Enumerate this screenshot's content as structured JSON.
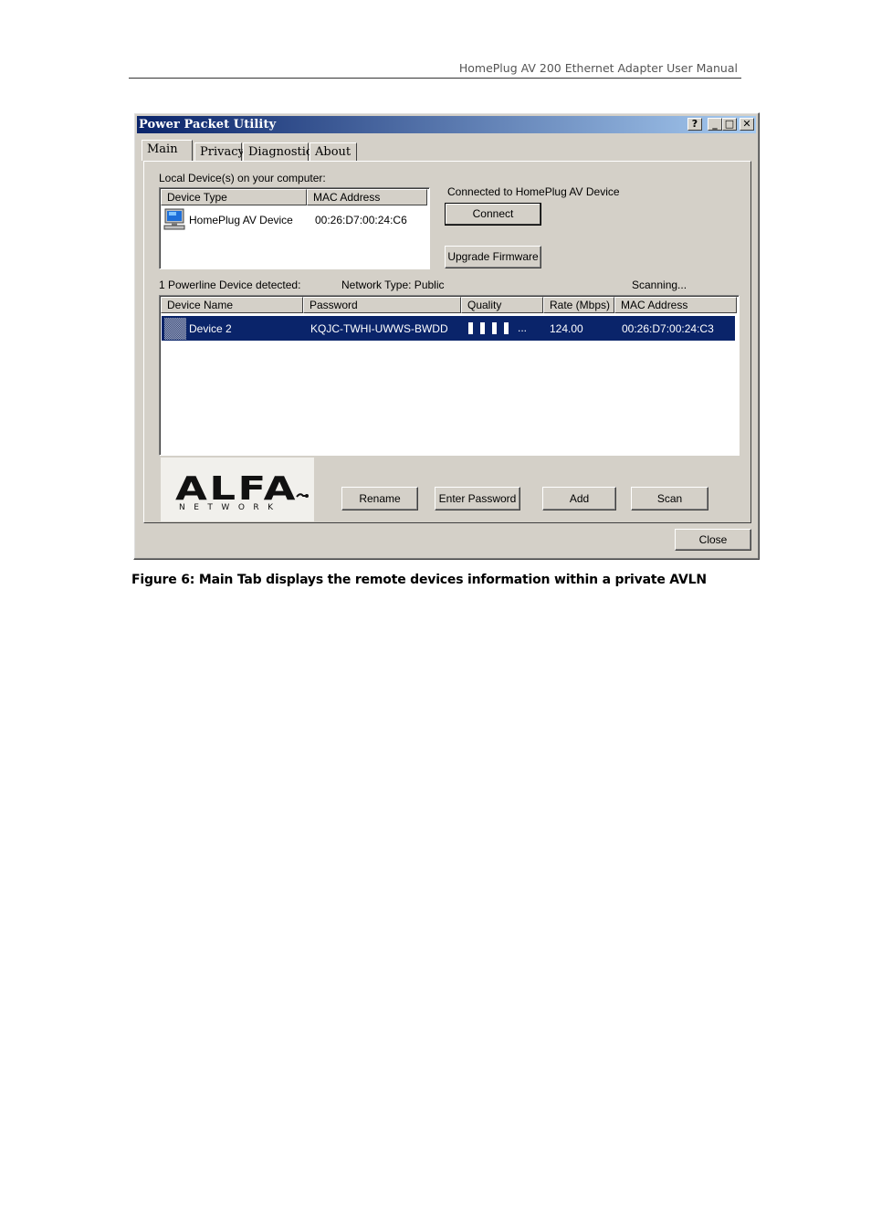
{
  "document": {
    "header_title": "HomePlug AV 200 Ethernet Adapter User Manual",
    "caption": "Figure 6: Main Tab displays the remote devices information within a private AVLN"
  },
  "window": {
    "title": "Power Packet Utility",
    "help_glyph": "?",
    "minimize_glyph": "_",
    "maximize_glyph": "□",
    "close_glyph": "✕",
    "tabs": [
      {
        "label": "Main",
        "active": true
      },
      {
        "label": "Privacy",
        "active": false
      },
      {
        "label": "Diagnostics",
        "active": false
      },
      {
        "label": "About",
        "active": false
      }
    ],
    "local": {
      "label": "Local Device(s) on your computer:",
      "columns": [
        "Device Type",
        "MAC Address"
      ],
      "rows": [
        {
          "icon": "computer-icon",
          "device_type": "HomePlug AV Device",
          "mac": "00:26:D7:00:24:C6"
        }
      ]
    },
    "connection_status": "Connected to HomePlug AV Device",
    "connect_label": "Connect",
    "upgrade_label": "Upgrade Firmware",
    "powerline_count": "1 Powerline Device detected:",
    "network_type": "Network Type: Public",
    "scan_status": "Scanning...",
    "remote": {
      "columns": [
        "Device Name",
        "Password",
        "Quality",
        "Rate (Mbps)",
        "MAC Address"
      ],
      "rows": [
        {
          "icon": "device-icon",
          "name": "Device 2",
          "password": "KQJC-TWHI-UWWS-BWDD",
          "quality_bars": 4,
          "quality_more": "...",
          "rate": "124.00",
          "mac": "00:26:D7:00:24:C3",
          "selected": true
        }
      ]
    },
    "logo": {
      "word": "ALFA",
      "sub": "NETWORK"
    },
    "buttons": {
      "rename": "Rename",
      "enter_password": "Enter Password",
      "add": "Add",
      "scan": "Scan",
      "close": "Close"
    },
    "colors": {
      "titlebar_start": "#0a246a",
      "titlebar_end": "#a6caf0",
      "selection": "#0a246a",
      "face": "#d4d0c8"
    }
  }
}
